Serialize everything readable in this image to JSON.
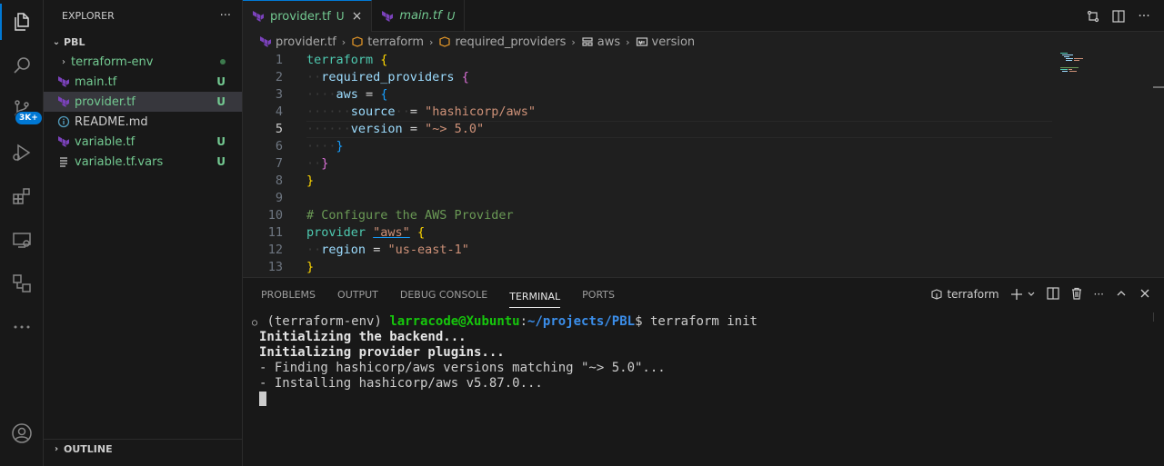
{
  "activity_bar": {
    "badge": "3K+"
  },
  "sidebar": {
    "title": "EXPLORER",
    "more": "···",
    "root": "PBL",
    "items": [
      {
        "label": "terraform-env",
        "status": "",
        "type": "folder"
      },
      {
        "label": "main.tf",
        "status": "U",
        "type": "terraform"
      },
      {
        "label": "provider.tf",
        "status": "U",
        "type": "terraform"
      },
      {
        "label": "README.md",
        "status": "",
        "type": "info"
      },
      {
        "label": "variable.tf",
        "status": "U",
        "type": "terraform"
      },
      {
        "label": "variable.tf.vars",
        "status": "U",
        "type": "lines"
      }
    ],
    "outline": "OUTLINE"
  },
  "tabs": [
    {
      "label": "provider.tf",
      "status": "U",
      "close": "×"
    },
    {
      "label": "main.tf",
      "status": "U"
    }
  ],
  "breadcrumb": [
    "provider.tf",
    "terraform",
    "required_providers",
    "aws",
    "version"
  ],
  "code_lines": [
    "1",
    "2",
    "3",
    "4",
    "5",
    "6",
    "7",
    "8",
    "9",
    "10",
    "11",
    "12",
    "13"
  ],
  "code": {
    "l1_kw": "terraform",
    "l1_br": "{",
    "l2_attr": "required_providers",
    "l2_br": "{",
    "l3_attr": "aws",
    "l3_eq": "=",
    "l3_br": "{",
    "l4_attr": "source",
    "l4_eq": "=",
    "l4_str": "\"hashicorp/aws\"",
    "l5_attr": "version",
    "l5_eq": "=",
    "l5_str": "\"~> 5.0\"",
    "l6_br": "}",
    "l7_br": "}",
    "l8_br": "}",
    "l10_cmt": "# Configure the AWS Provider",
    "l11_kw": "provider",
    "l11_str": "\"aws\"",
    "l11_br": "{",
    "l12_attr": "region",
    "l12_eq": "=",
    "l12_str": "\"us-east-1\"",
    "l13_br": "}"
  },
  "panel": {
    "tabs": [
      "PROBLEMS",
      "OUTPUT",
      "DEBUG CONSOLE",
      "TERMINAL",
      "PORTS"
    ],
    "terminal_name": "terraform",
    "terminal": {
      "prompt_env": "(terraform-env)",
      "prompt_user": "larracode@Xubuntu",
      "prompt_colon": ":",
      "prompt_path": "~/projects/PBL",
      "prompt_end": "$",
      "command": "terraform init",
      "line2": "Initializing the backend...",
      "line3": "Initializing provider plugins...",
      "line4": "- Finding hashicorp/aws versions matching \"~> 5.0\"...",
      "line5": "- Installing hashicorp/aws v5.87.0..."
    }
  },
  "colors": {
    "accent": "#0078d4",
    "untracked": "#73c991",
    "terraform": "#7b42bc"
  }
}
